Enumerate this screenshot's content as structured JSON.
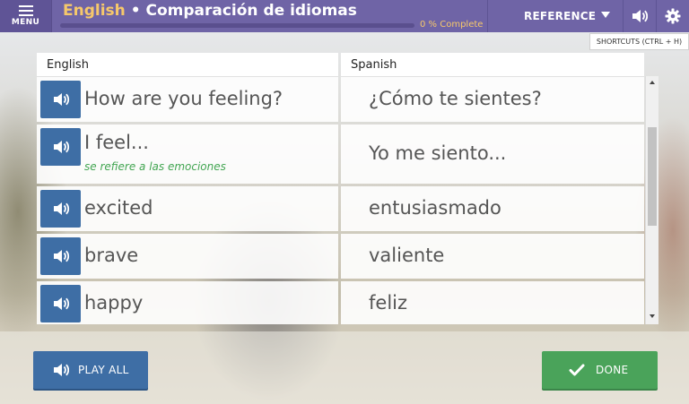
{
  "header": {
    "menu_label": "MENU",
    "title_language": "English",
    "title_separator": "•",
    "title_text": "Comparación de idiomas",
    "progress_percent": 0,
    "progress_label": "0 % Complete",
    "reference_label": "REFERENCE",
    "tooltip": "SHORTCUTS (CTRL + H)"
  },
  "table": {
    "col_english": "English",
    "col_spanish": "Spanish",
    "rows": [
      {
        "english": "How are you feeling?",
        "spanish": "¿Cómo te sientes?"
      },
      {
        "english": "I feel...",
        "note": "se refiere a las emociones",
        "spanish": "Yo me siento..."
      },
      {
        "english": "excited",
        "spanish": "entusiasmado"
      },
      {
        "english": "brave",
        "spanish": "valiente"
      },
      {
        "english": "happy",
        "spanish": "feliz"
      }
    ]
  },
  "footer": {
    "play_all_label": "PLAY ALL",
    "done_label": "DONE"
  },
  "colors": {
    "topbar": "#6f64a6",
    "accent_yellow": "#f6c86b",
    "button_blue": "#3e6ea5",
    "button_green": "#4aa35a",
    "note_green": "#43a653"
  }
}
